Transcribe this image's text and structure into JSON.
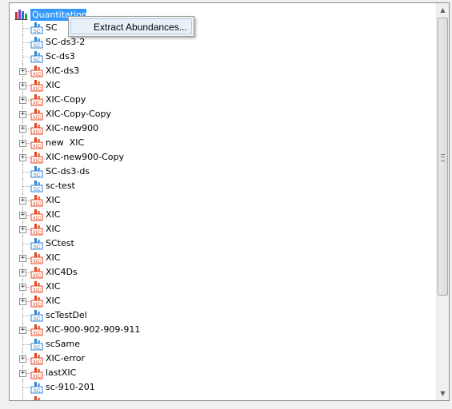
{
  "tree": {
    "root": {
      "label": "Quantitation",
      "icon": "bar-chart-icon"
    },
    "items": [
      {
        "label": "SC",
        "type": "sc",
        "expandable": false
      },
      {
        "label": "SC-ds3-2",
        "type": "sc",
        "expandable": false
      },
      {
        "label": "Sc-ds3",
        "type": "sc",
        "expandable": false
      },
      {
        "label": "XIC-ds3",
        "type": "xic",
        "expandable": true
      },
      {
        "label": "XIC",
        "type": "xic",
        "expandable": true
      },
      {
        "label": "XIC-Copy",
        "type": "xic",
        "expandable": true
      },
      {
        "label": "XIC-Copy-Copy",
        "type": "xic",
        "expandable": true
      },
      {
        "label": "XIC-new900",
        "type": "xic",
        "expandable": true
      },
      {
        "label": "new  XIC",
        "type": "xic",
        "expandable": true
      },
      {
        "label": "XIC-new900-Copy",
        "type": "xic",
        "expandable": true
      },
      {
        "label": "SC-ds3-ds",
        "type": "sc",
        "expandable": false
      },
      {
        "label": "sc-test",
        "type": "sc",
        "expandable": false
      },
      {
        "label": "XIC",
        "type": "xic",
        "expandable": true
      },
      {
        "label": "XIC",
        "type": "xic",
        "expandable": true
      },
      {
        "label": "XIC",
        "type": "xic",
        "expandable": true
      },
      {
        "label": "SCtest",
        "type": "sc",
        "expandable": false
      },
      {
        "label": "XIC",
        "type": "xic",
        "expandable": true
      },
      {
        "label": "XIC4Ds",
        "type": "xic",
        "expandable": true
      },
      {
        "label": "XIC",
        "type": "xic",
        "expandable": true
      },
      {
        "label": "XIC",
        "type": "xic",
        "expandable": true
      },
      {
        "label": "scTestDel",
        "type": "sc",
        "expandable": false
      },
      {
        "label": "XIC-900-902-909-911",
        "type": "xic",
        "expandable": true
      },
      {
        "label": "scSame",
        "type": "sc",
        "expandable": false
      },
      {
        "label": "XIC-error",
        "type": "xic",
        "expandable": true
      },
      {
        "label": "lastXIC",
        "type": "xic",
        "expandable": true
      },
      {
        "label": "sc-910-201",
        "type": "sc",
        "expandable": false
      },
      {
        "label": "",
        "type": "xic",
        "expandable": false
      }
    ]
  },
  "context_menu": {
    "items": [
      {
        "label": "Extract Abundances..."
      }
    ]
  },
  "icon_text": {
    "sc": "SC",
    "xic": "XIC"
  },
  "colors": {
    "selection": "#3399ff",
    "sc_icon": "#2f86d4",
    "xic_icon": "#e8441c"
  }
}
